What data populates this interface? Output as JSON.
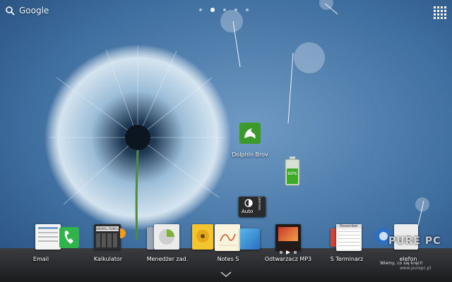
{
  "search": {
    "label": "Google"
  },
  "pager": {
    "pages": 5,
    "active": 2
  },
  "shortcuts": {
    "dolphin": {
      "label": "Dolphin Brov"
    },
    "autobrightness": {
      "label": "Auto",
      "side_label": "Jasnosc"
    }
  },
  "battery_widget": {
    "label": "60%"
  },
  "dock": {
    "items": [
      {
        "label": "Email"
      },
      {
        "label": "Kalkulator",
        "display": "480/60=70/80=8"
      },
      {
        "label": "Menedżer zad."
      },
      {
        "label": "Notes S"
      },
      {
        "label": "Odtwarzacz MP3"
      },
      {
        "label": "S Terminarz",
        "month": "November"
      },
      {
        "label": "elefon"
      }
    ]
  },
  "watermark": {
    "brand": "PURE PC",
    "slogan": "Wiemy, co się kręci!",
    "url": "www.purepc.pl"
  },
  "colors": {
    "wallpaper": "#3f6fa0",
    "dock": "#26272a",
    "dolphin": "#3b9a2a"
  }
}
